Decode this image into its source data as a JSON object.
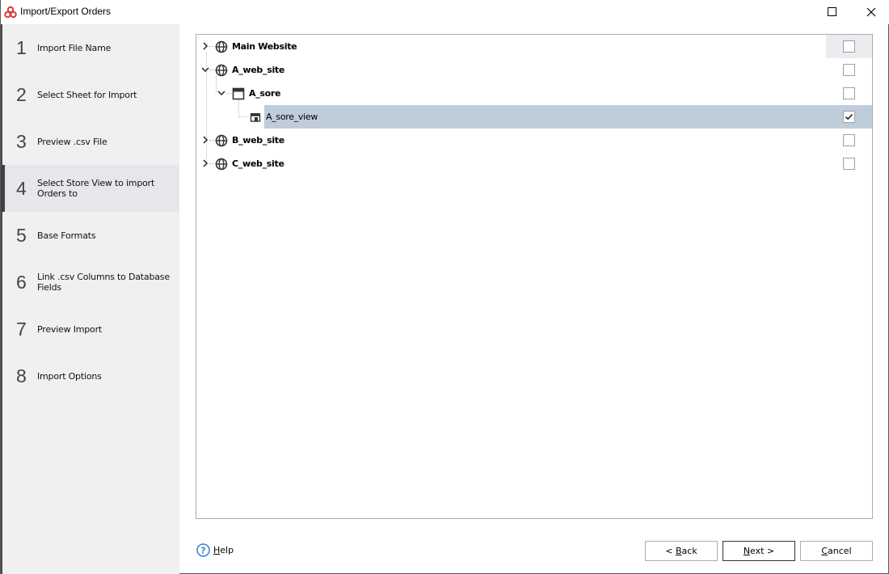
{
  "window": {
    "title": "Import/Export Orders",
    "app_icon": "app-logo-icon",
    "controls": [
      "maximize-icon",
      "close-icon"
    ]
  },
  "sidebar": {
    "steps": [
      {
        "num": "1",
        "label": "Import File Name",
        "active": false
      },
      {
        "num": "2",
        "label": "Select Sheet for Import",
        "active": false
      },
      {
        "num": "3",
        "label": "Preview .csv File",
        "active": false
      },
      {
        "num": "4",
        "label": "Select Store View to import Orders to",
        "active": true
      },
      {
        "num": "5",
        "label": "Base Formats",
        "active": false
      },
      {
        "num": "6",
        "label": "Link .csv Columns to Database Fields",
        "active": false
      },
      {
        "num": "7",
        "label": "Preview Import",
        "active": false
      },
      {
        "num": "8",
        "label": "Import Options",
        "active": false
      }
    ]
  },
  "tree": {
    "nodes": [
      {
        "label": "Main Website",
        "type": "website",
        "icon": "globe-icon",
        "level": 0,
        "expander": "collapsed",
        "checked": false,
        "bold": true
      },
      {
        "label": "A_web_site",
        "type": "website",
        "icon": "globe-icon",
        "level": 0,
        "expander": "expanded",
        "checked": false,
        "bold": true
      },
      {
        "label": "A_sore",
        "type": "store",
        "icon": "store-window-icon",
        "level": 1,
        "expander": "expanded",
        "checked": false,
        "bold": true
      },
      {
        "label": "A_sore_view",
        "type": "store-view",
        "icon": "store-view-icon",
        "level": 2,
        "expander": "none",
        "checked": true,
        "bold": false,
        "selected": true
      },
      {
        "label": "B_web_site",
        "type": "website",
        "icon": "globe-icon",
        "level": 0,
        "expander": "collapsed",
        "checked": false,
        "bold": true
      },
      {
        "label": "C_web_site",
        "type": "website",
        "icon": "globe-icon",
        "level": 0,
        "expander": "collapsed",
        "checked": false,
        "bold": true
      }
    ]
  },
  "footer": {
    "help_label": "Help",
    "help_mnemonic": "H",
    "back_prefix": "< ",
    "back_mnemonic": "B",
    "back_rest": "ack",
    "next_mnemonic": "N",
    "next_rest": "ext >",
    "cancel_mnemonic": "C",
    "cancel_rest": "ancel"
  },
  "colors": {
    "selection": "#bfcddb",
    "active_step_bg": "#e6e6ec",
    "active_step_bar": "#404047",
    "sidebar_bg": "#f0f0f0",
    "help_blue": "#3b7fd4",
    "logo_red": "#d83a3a"
  }
}
